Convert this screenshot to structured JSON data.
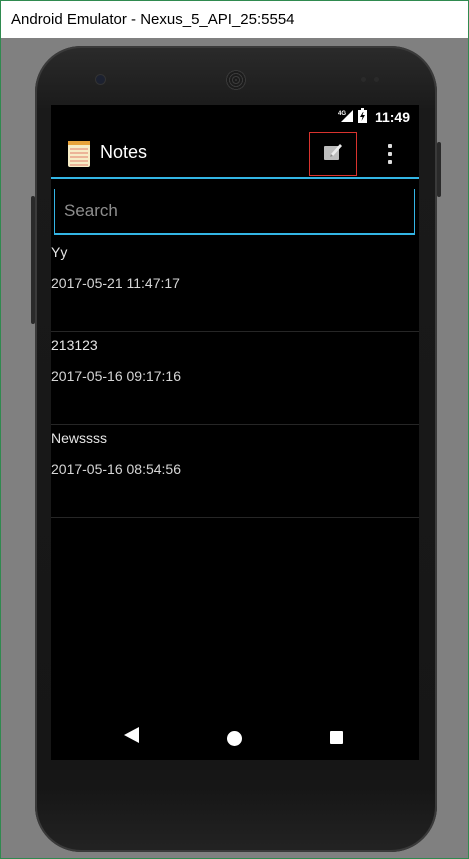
{
  "window": {
    "title": "Android Emulator - Nexus_5_API_25:5554"
  },
  "status_bar": {
    "network": "4G",
    "time": "11:49"
  },
  "app_bar": {
    "title": "Notes",
    "compose_icon": "compose-note-icon",
    "overflow_icon": "overflow-menu-icon"
  },
  "search": {
    "placeholder": "Search",
    "value": ""
  },
  "notes": [
    {
      "title": "Yy",
      "date": "2017-05-21 11:47:17"
    },
    {
      "title": "213123",
      "date": "2017-05-16 09:17:16"
    },
    {
      "title": "Newssss",
      "date": "2017-05-16 08:54:56"
    }
  ],
  "nav": {
    "back_icon": "back-icon",
    "home_icon": "home-icon",
    "recents_icon": "recents-icon"
  },
  "colors": {
    "accent": "#33b5e5",
    "highlight": "#d9332e",
    "background": "#000000"
  }
}
